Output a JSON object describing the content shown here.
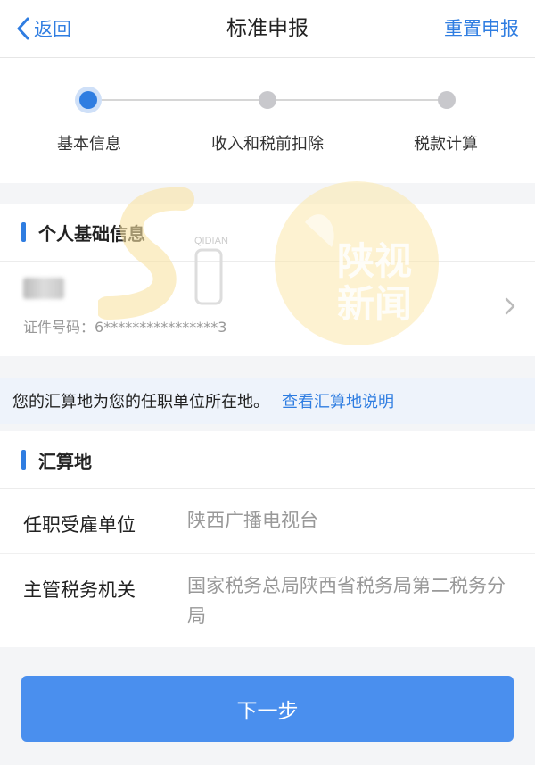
{
  "nav": {
    "back_label": "返回",
    "title": "标准申报",
    "reset_label": "重置申报"
  },
  "steps": [
    {
      "label": "基本信息",
      "active": true
    },
    {
      "label": "收入和税前扣除",
      "active": false
    },
    {
      "label": "税款计算",
      "active": false
    }
  ],
  "personal": {
    "section_title": "个人基础信息",
    "id_label": "证件号码：",
    "id_value": "6****************3"
  },
  "notice": {
    "text": "您的汇算地为您的任职单位所在地。",
    "link": "查看汇算地说明"
  },
  "settlement": {
    "section_title": "汇算地",
    "employer_label": "任职受雇单位",
    "employer_value": "陕西广播电视台",
    "tax_authority_label": "主管税务机关",
    "tax_authority_value": "国家税务总局陕西省税务局第二税务分局"
  },
  "next_label": "下一步",
  "watermark": {
    "left_text": "QIDIAN",
    "right_text_line1": "陕视",
    "right_text_line2": "新闻"
  },
  "colors": {
    "accent": "#2f7de1",
    "button": "#4a8fee",
    "notice_bg": "#eef3fb"
  }
}
